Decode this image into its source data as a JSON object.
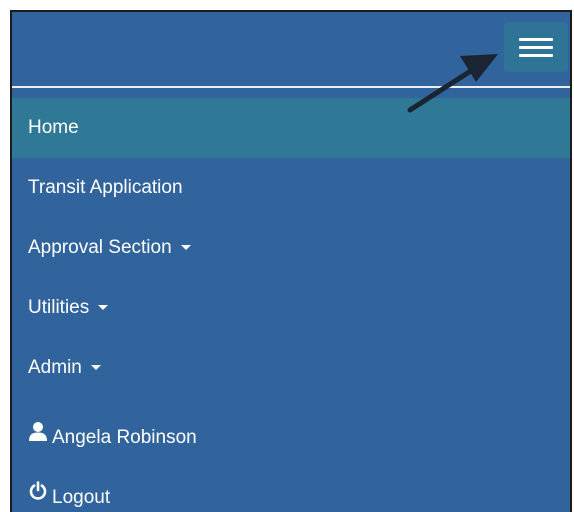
{
  "navbar": {
    "toggle_icon": "hamburger-menu-icon"
  },
  "menu": {
    "items": [
      {
        "label": "Home"
      },
      {
        "label": "Transit Application"
      },
      {
        "label": "Approval Section"
      },
      {
        "label": "Utilities"
      },
      {
        "label": "Admin"
      }
    ],
    "user": {
      "label": "Angela Robinson",
      "icon": "user-icon"
    },
    "logout": {
      "label": "Logout",
      "icon": "power-icon"
    }
  },
  "annotation": {
    "icon": "arrow-icon",
    "color": "#1a2433"
  },
  "colors": {
    "navbar_bg": "#31649c",
    "active_item_bg": "#2f7896",
    "toggle_bg": "#2f7496",
    "text": "#ffffff"
  }
}
